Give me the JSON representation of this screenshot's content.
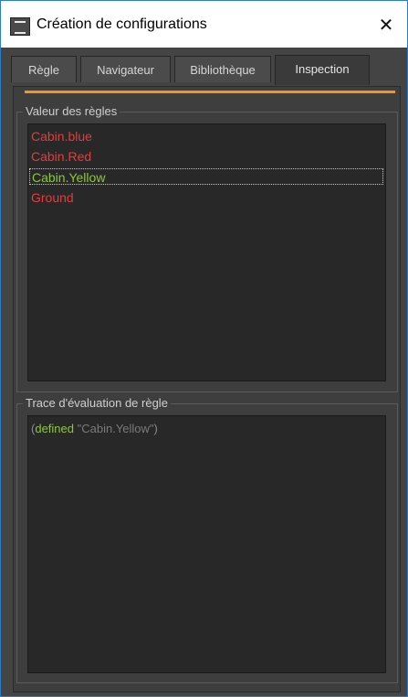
{
  "window": {
    "title": "Création de configurations",
    "close_glyph": "✕"
  },
  "tabs": [
    {
      "label": "Règle",
      "active": false
    },
    {
      "label": "Navigateur",
      "active": false
    },
    {
      "label": "Bibliothèque",
      "active": false
    },
    {
      "label": "Inspection",
      "active": true
    }
  ],
  "accent_color": "#f7941d",
  "rule_values": {
    "title": "Valeur des règles",
    "items": [
      {
        "label": "Cabin.blue",
        "color": "#e43c3c"
      },
      {
        "label": "Cabin.Red",
        "color": "#e43c3c"
      },
      {
        "label": "Cabin.Yellow",
        "color": "#8ec63f",
        "selected": true
      },
      {
        "label": "Ground",
        "color": "#e43c3c"
      }
    ]
  },
  "trace": {
    "title": "Trace d'évaluation de règle",
    "open_paren": "(",
    "keyword": "defined",
    "argument": "\"Cabin.Yellow\"",
    "close_paren": ")"
  }
}
